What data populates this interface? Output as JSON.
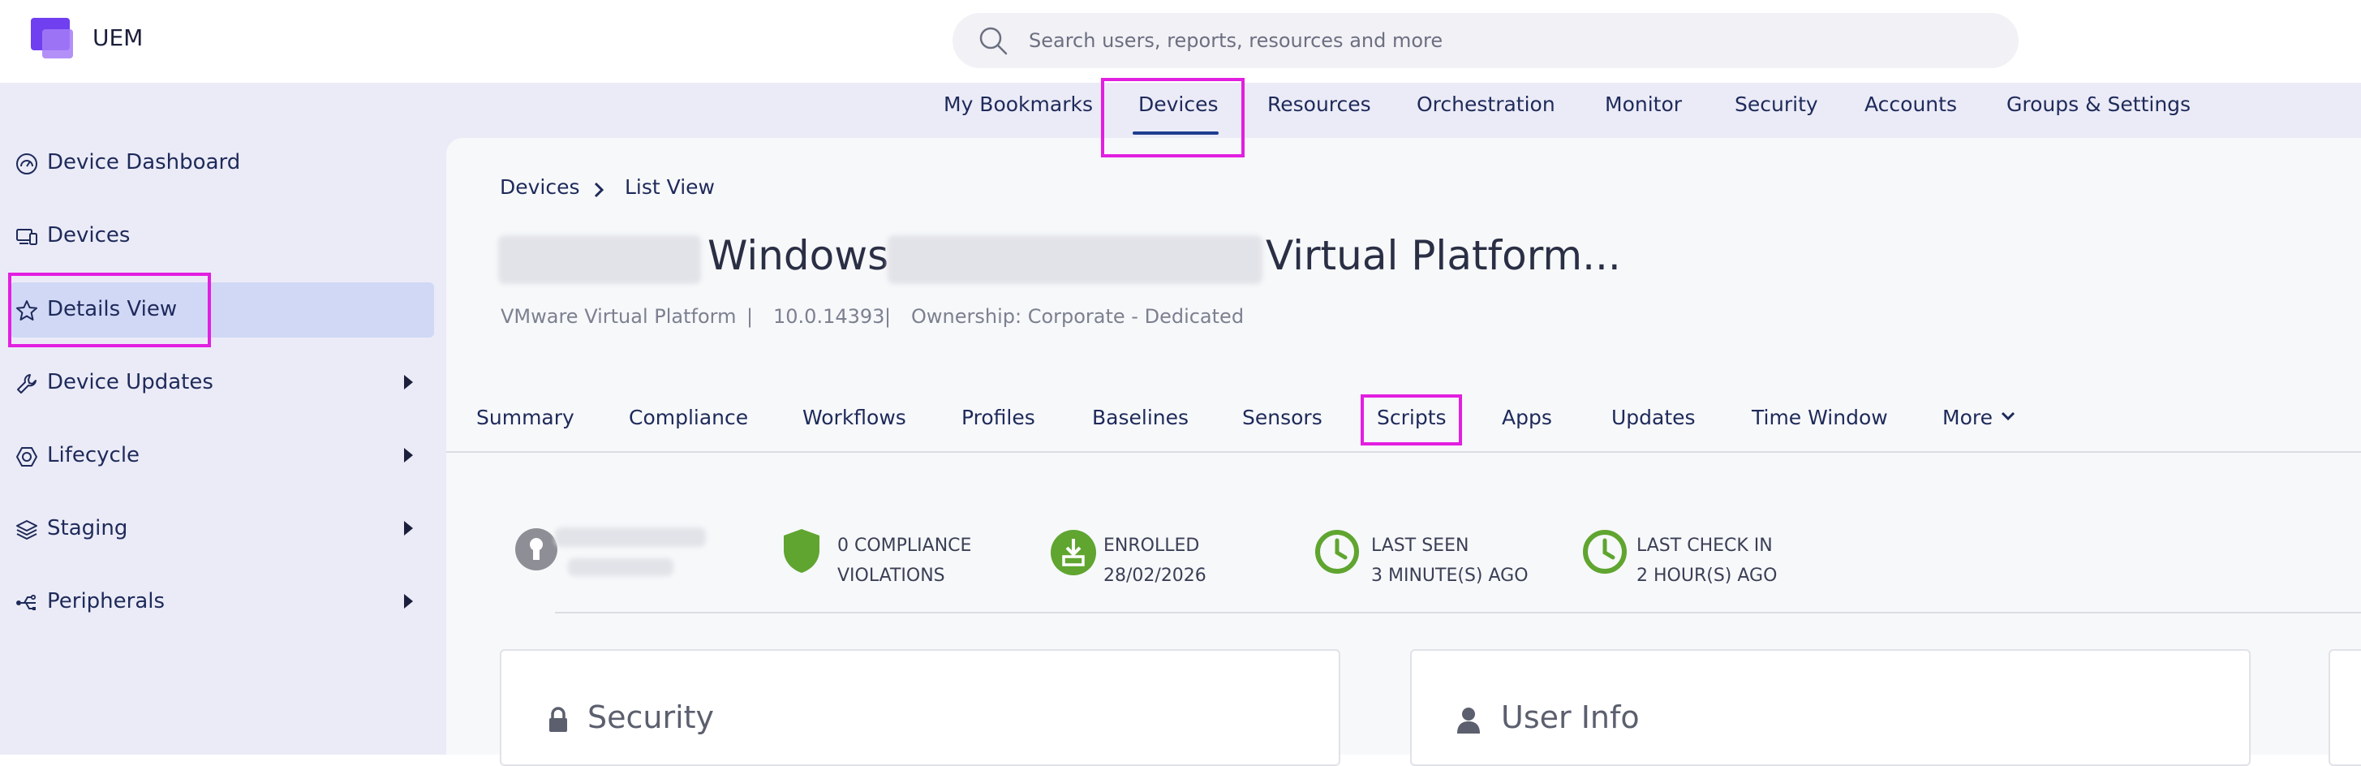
{
  "app": {
    "name": "UEM"
  },
  "search": {
    "placeholder": "Search users, reports, resources and more"
  },
  "top_nav": {
    "items": [
      "My Bookmarks",
      "Devices",
      "Resources",
      "Orchestration",
      "Monitor",
      "Security",
      "Accounts",
      "Groups & Settings"
    ],
    "active": "Devices"
  },
  "sidebar": {
    "items": [
      {
        "label": "Device Dashboard",
        "icon": "dashboard-icon",
        "expandable": false
      },
      {
        "label": "Devices",
        "icon": "devices-icon",
        "expandable": false
      },
      {
        "label": "Details View",
        "icon": "star-icon",
        "expandable": false,
        "active": true
      },
      {
        "label": "Device Updates",
        "icon": "wrench-icon",
        "expandable": true
      },
      {
        "label": "Lifecycle",
        "icon": "lifecycle-icon",
        "expandable": true
      },
      {
        "label": "Staging",
        "icon": "layers-icon",
        "expandable": true
      },
      {
        "label": "Peripherals",
        "icon": "usb-icon",
        "expandable": true
      }
    ]
  },
  "breadcrumb": {
    "root": "Devices",
    "current": "List View"
  },
  "device": {
    "title_part1": "Windows",
    "title_part2": "Virtual Platform...",
    "model": "VMware Virtual Platform",
    "os_version": "10.0.14393",
    "ownership": "Ownership: Corporate - Dedicated",
    "separator": "|"
  },
  "tabs": {
    "items": [
      "Summary",
      "Compliance",
      "Workflows",
      "Profiles",
      "Baselines",
      "Sensors",
      "Scripts",
      "Apps",
      "Updates",
      "Time Window",
      "More"
    ],
    "highlighted": "Scripts"
  },
  "status": {
    "compliance_line1": "0 COMPLIANCE",
    "compliance_line2": "VIOLATIONS",
    "enrolled_line1": "ENROLLED",
    "enrolled_line2": "28/02/2026",
    "last_seen_line1": "LAST SEEN",
    "last_seen_line2": "3 MINUTE(S) AGO",
    "last_checkin_line1": "LAST CHECK IN",
    "last_checkin_line2": "2 HOUR(S) AGO"
  },
  "cards": {
    "security_title": "Security",
    "user_info_title": "User Info"
  },
  "colors": {
    "accent": "#1e3e8f",
    "highlight": "#e21fe0",
    "status_green": "#5fa530",
    "sidebar_bg": "#ebebf7",
    "active_item": "#d0d8f6"
  }
}
